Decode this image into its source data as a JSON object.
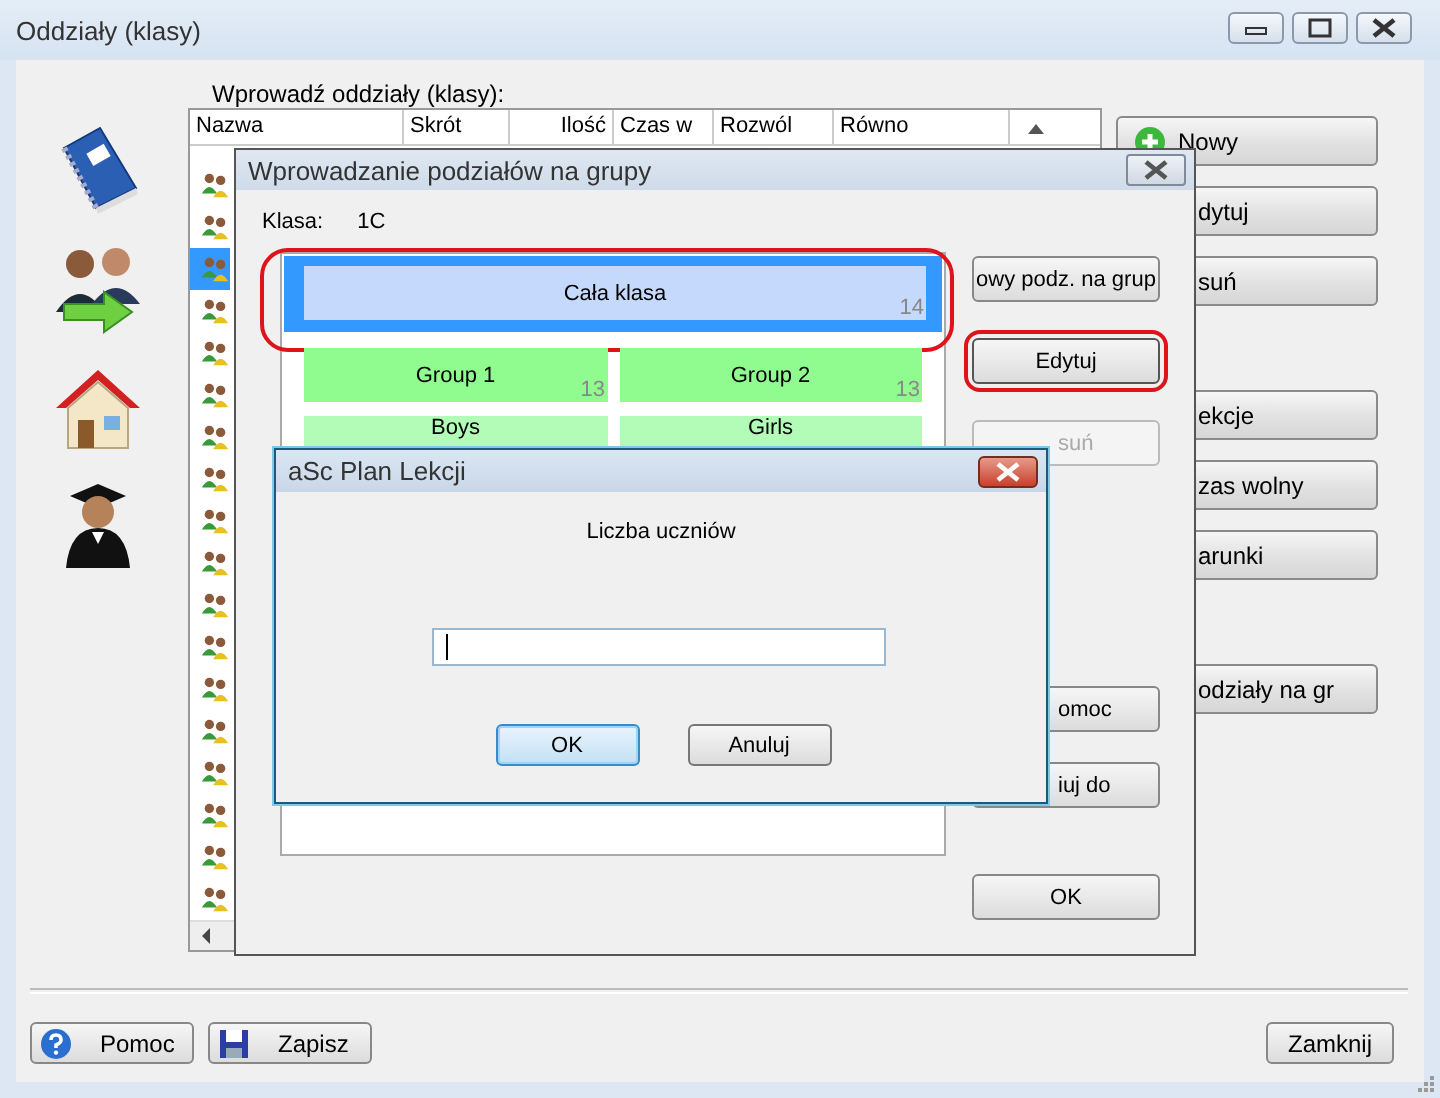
{
  "window": {
    "title": "Oddziały (klasy)"
  },
  "classes": {
    "label": "Wprowadź oddziały (klasy):",
    "columns": [
      "Nazwa",
      "Skrót",
      "Ilość",
      "Czas w",
      "Rozwól",
      "Równo"
    ],
    "rows": [
      {
        "selected": false
      },
      {
        "selected": false
      },
      {
        "selected": true
      },
      {
        "selected": false
      },
      {
        "selected": false
      },
      {
        "selected": false
      },
      {
        "selected": false
      },
      {
        "selected": false
      },
      {
        "selected": false
      },
      {
        "selected": false
      },
      {
        "selected": false
      },
      {
        "selected": false
      },
      {
        "selected": false
      },
      {
        "selected": false
      },
      {
        "selected": false
      },
      {
        "selected": false
      },
      {
        "selected": false
      },
      {
        "selected": false
      }
    ]
  },
  "side_buttons": [
    [
      {
        "label": "Nowy",
        "kind": "add"
      },
      {
        "label": "dytuj",
        "kind": "plain"
      },
      {
        "label": "suń",
        "kind": "plain"
      }
    ],
    [
      {
        "label": "ekcje",
        "kind": "plain"
      },
      {
        "label": "zas wolny",
        "kind": "plain"
      },
      {
        "label": "arunki",
        "kind": "plain"
      }
    ],
    [
      {
        "label": "odziały na gr",
        "kind": "plain"
      }
    ]
  ],
  "footer": {
    "buttons": [
      {
        "label": "Pomoc",
        "kind": "help"
      },
      {
        "label": "Zapisz",
        "kind": "save"
      },
      {
        "label": "Zamknij",
        "kind": "plain"
      }
    ]
  },
  "split_dialog": {
    "title": "Wprowadzanie podziałów na grupy",
    "class_label": "Klasa:",
    "class_value": "1C",
    "divisions": [
      {
        "selected": true,
        "highlighted": true,
        "groups": [
          {
            "name": "Cała klasa",
            "count": "14",
            "color": "#c5d9fc"
          }
        ]
      },
      {
        "selected": false,
        "highlighted": false,
        "groups": [
          {
            "name": "Group 1",
            "count": "13",
            "color": "#90fc90"
          },
          {
            "name": "Group 2",
            "count": "13",
            "color": "#90fc90"
          }
        ]
      },
      {
        "selected": false,
        "highlighted": false,
        "groups": [
          {
            "name": "Boys",
            "color": "#b2fcb8"
          },
          {
            "name": "Girls",
            "color": "#b2fcb8"
          }
        ]
      }
    ],
    "buttons": [
      [
        {
          "label": "owy podz. na grup",
          "disabled": false,
          "highlighted": false
        },
        {
          "label": "Edytuj",
          "disabled": false,
          "highlighted": true
        },
        {
          "label": "suń",
          "disabled": true,
          "highlighted": false
        }
      ],
      [
        {
          "label": "omoc",
          "disabled": false,
          "highlighted": false
        },
        {
          "label": "iuj do",
          "disabled": false,
          "highlighted": false
        }
      ],
      [
        {
          "label": "OK",
          "disabled": false,
          "highlighted": false
        }
      ]
    ]
  },
  "prompt_dialog": {
    "title": "aSc Plan Lekcji",
    "label": "Liczba uczniów",
    "buttons": [
      {
        "label": "OK",
        "focused": true
      },
      {
        "label": "Anuluj",
        "focused": false
      }
    ]
  }
}
